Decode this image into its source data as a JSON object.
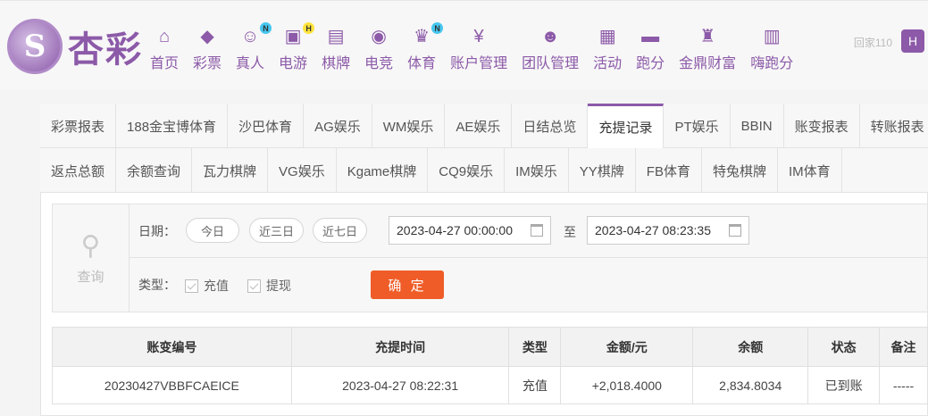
{
  "brand": {
    "logo_text": "杏彩",
    "mark_glyph": "S"
  },
  "nav": [
    {
      "label": "首页",
      "icon": "home-icon",
      "glyph": "⌂",
      "badge": ""
    },
    {
      "label": "彩票",
      "icon": "lottery-ticket-icon",
      "glyph": "◆",
      "badge": ""
    },
    {
      "label": "真人",
      "icon": "live-dealer-icon",
      "glyph": "☺",
      "badge": "N"
    },
    {
      "label": "电游",
      "icon": "gamepad-icon",
      "glyph": "▣",
      "badge": "H"
    },
    {
      "label": "棋牌",
      "icon": "cards-icon",
      "glyph": "▤",
      "badge": ""
    },
    {
      "label": "电竞",
      "icon": "esports-controller-icon",
      "glyph": "◉",
      "badge": ""
    },
    {
      "label": "体育",
      "icon": "trophy-icon",
      "glyph": "♛",
      "badge": "N"
    },
    {
      "label": "账户管理",
      "icon": "yen-coin-icon",
      "glyph": "¥",
      "badge": ""
    },
    {
      "label": "团队管理",
      "icon": "team-icon",
      "glyph": "☻",
      "badge": ""
    },
    {
      "label": "活动",
      "icon": "gift-icon",
      "glyph": "▦",
      "badge": ""
    },
    {
      "label": "跑分",
      "icon": "train-icon",
      "glyph": "▬",
      "badge": ""
    },
    {
      "label": "金鼎财富",
      "icon": "ding-icon",
      "glyph": "♜",
      "badge": ""
    },
    {
      "label": "嗨跑分",
      "icon": "hi-icon",
      "glyph": "▥",
      "badge": ""
    }
  ],
  "watermark": {
    "text": "回家110",
    "badge": "H"
  },
  "tabs_row1": [
    "彩票报表",
    "188金宝博体育",
    "沙巴体育",
    "AG娱乐",
    "WM娱乐",
    "AE娱乐",
    "日结总览",
    "充提记录",
    "PT娱乐",
    "BBIN",
    "账变报表",
    "转账报表"
  ],
  "tabs_row2": [
    "返点总额",
    "余额查询",
    "瓦力棋牌",
    "VG娱乐",
    "Kgame棋牌",
    "CQ9娱乐",
    "IM娱乐",
    "YY棋牌",
    "FB体育",
    "特兔棋牌",
    "IM体育"
  ],
  "active_tab": "充提记录",
  "query": {
    "icon_label": "查询",
    "date_label": "日期：",
    "today": "今日",
    "last3": "近三日",
    "last7": "近七日",
    "start": "2023-04-27 00:00:00",
    "to": "至",
    "end": "2023-04-27 08:23:35",
    "type_label": "类型：",
    "deposit": "充值",
    "withdraw": "提现",
    "confirm": "确 定"
  },
  "table": {
    "headers": [
      "账变编号",
      "充提时间",
      "类型",
      "金额/元",
      "余额",
      "状态",
      "备注"
    ],
    "rows": [
      [
        "20230427VBBFCAEICE",
        "2023-04-27 08:22:31",
        "充值",
        "+2,018.4000",
        "2,834.8034",
        "已到账",
        "-----"
      ]
    ]
  },
  "colors": {
    "brand": "#8c5aa8",
    "confirm": "#ef5c27",
    "amount": "#d91a1a",
    "status_ok": "#2b9a2b"
  }
}
